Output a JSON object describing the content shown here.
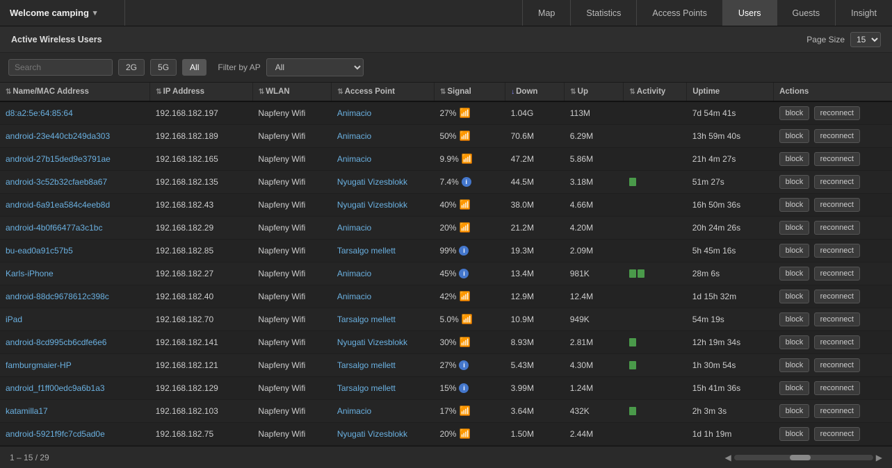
{
  "brand": {
    "name": "Welcome camping",
    "arrow": "▾"
  },
  "nav": {
    "tabs": [
      {
        "id": "map",
        "label": "Map",
        "active": false
      },
      {
        "id": "statistics",
        "label": "Statistics",
        "active": false
      },
      {
        "id": "access-points",
        "label": "Access Points",
        "active": false
      },
      {
        "id": "users",
        "label": "Users",
        "active": true
      },
      {
        "id": "guests",
        "label": "Guests",
        "active": false
      },
      {
        "id": "insight",
        "label": "Insight",
        "active": false
      }
    ]
  },
  "section": {
    "title": "Active Wireless Users",
    "page_size_label": "Page Size",
    "page_size_value": "15"
  },
  "filters": {
    "search_placeholder": "Search",
    "btn_2g": "2G",
    "btn_5g": "5G",
    "btn_all": "All",
    "filter_by_ap_label": "Filter by AP",
    "filter_by_ap_value": "All"
  },
  "table": {
    "columns": [
      {
        "id": "name",
        "label": "Name/MAC Address",
        "sort": "asc"
      },
      {
        "id": "ip",
        "label": "IP Address",
        "sort": "none"
      },
      {
        "id": "wlan",
        "label": "WLAN",
        "sort": "none"
      },
      {
        "id": "ap",
        "label": "Access Point",
        "sort": "none"
      },
      {
        "id": "signal",
        "label": "Signal",
        "sort": "none"
      },
      {
        "id": "down",
        "label": "Down",
        "sort": "desc"
      },
      {
        "id": "up",
        "label": "Up",
        "sort": "none"
      },
      {
        "id": "activity",
        "label": "Activity",
        "sort": "none"
      },
      {
        "id": "uptime",
        "label": "Uptime",
        "sort": "none"
      },
      {
        "id": "actions",
        "label": "Actions",
        "sort": "none"
      }
    ],
    "rows": [
      {
        "name": "d8:a2:5e:64:85:64",
        "ip": "192.168.182.197",
        "wlan": "Napfeny Wifi",
        "ap": "Animacio",
        "ap_link": true,
        "signal": "27%",
        "signal_type": "wifi",
        "down": "1.04G",
        "up": "113M",
        "activity": 0,
        "uptime": "7d 54m 41s"
      },
      {
        "name": "android-23e440cb249da303",
        "ip": "192.168.182.189",
        "wlan": "Napfeny Wifi",
        "ap": "Animacio",
        "ap_link": true,
        "signal": "50%",
        "signal_type": "wifi",
        "down": "70.6M",
        "up": "6.29M",
        "activity": 0,
        "uptime": "13h 59m 40s"
      },
      {
        "name": "android-27b15ded9e3791ae",
        "ip": "192.168.182.165",
        "wlan": "Napfeny Wifi",
        "ap": "Animacio",
        "ap_link": true,
        "signal": "9.9%",
        "signal_type": "wifi",
        "down": "47.2M",
        "up": "5.86M",
        "activity": 0,
        "uptime": "21h 4m 27s"
      },
      {
        "name": "android-3c52b32cfaeb8a67",
        "ip": "192.168.182.135",
        "wlan": "Napfeny Wifi",
        "ap": "Nyugati Vizesblokk",
        "ap_link": true,
        "signal": "7.4%",
        "signal_type": "info",
        "down": "44.5M",
        "up": "3.18M",
        "activity": 1,
        "uptime": "51m 27s"
      },
      {
        "name": "android-6a91ea584c4eeb8d",
        "ip": "192.168.182.43",
        "wlan": "Napfeny Wifi",
        "ap": "Nyugati Vizesblokk",
        "ap_link": true,
        "signal": "40%",
        "signal_type": "wifi",
        "down": "38.0M",
        "up": "4.66M",
        "activity": 0,
        "uptime": "16h 50m 36s"
      },
      {
        "name": "android-4b0f66477a3c1bc",
        "ip": "192.168.182.29",
        "wlan": "Napfeny Wifi",
        "ap": "Animacio",
        "ap_link": true,
        "signal": "20%",
        "signal_type": "wifi",
        "down": "21.2M",
        "up": "4.20M",
        "activity": 0,
        "uptime": "20h 24m 26s"
      },
      {
        "name": "bu-ead0a91c57b5",
        "ip": "192.168.182.85",
        "wlan": "Napfeny Wifi",
        "ap": "Tarsalgo mellett",
        "ap_link": true,
        "signal": "99%",
        "signal_type": "info",
        "down": "19.3M",
        "up": "2.09M",
        "activity": 0,
        "uptime": "5h 45m 16s"
      },
      {
        "name": "Karls-iPhone",
        "ip": "192.168.182.27",
        "wlan": "Napfeny Wifi",
        "ap": "Animacio",
        "ap_link": true,
        "signal": "45%",
        "signal_type": "info",
        "down": "13.4M",
        "up": "981K",
        "activity": 2,
        "uptime": "28m 6s"
      },
      {
        "name": "android-88dc9678612c398c",
        "ip": "192.168.182.40",
        "wlan": "Napfeny Wifi",
        "ap": "Animacio",
        "ap_link": true,
        "signal": "42%",
        "signal_type": "wifi",
        "down": "12.9M",
        "up": "12.4M",
        "activity": 0,
        "uptime": "1d 15h 32m"
      },
      {
        "name": "iPad",
        "ip": "192.168.182.70",
        "wlan": "Napfeny Wifi",
        "ap": "Tarsalgo mellett",
        "ap_link": true,
        "signal": "5.0%",
        "signal_type": "wifi",
        "down": "10.9M",
        "up": "949K",
        "activity": 0,
        "uptime": "54m 19s"
      },
      {
        "name": "android-8cd995cb6cdfe6e6",
        "ip": "192.168.182.141",
        "wlan": "Napfeny Wifi",
        "ap": "Nyugati Vizesblokk",
        "ap_link": true,
        "signal": "30%",
        "signal_type": "wifi",
        "down": "8.93M",
        "up": "2.81M",
        "activity": 1,
        "uptime": "12h 19m 34s"
      },
      {
        "name": "famburgmaier-HP",
        "ip": "192.168.182.121",
        "wlan": "Napfeny Wifi",
        "ap": "Tarsalgo mellett",
        "ap_link": true,
        "signal": "27%",
        "signal_type": "info",
        "down": "5.43M",
        "up": "4.30M",
        "activity": 1,
        "uptime": "1h 30m 54s"
      },
      {
        "name": "android_f1ff00edc9a6b1a3",
        "ip": "192.168.182.129",
        "wlan": "Napfeny Wifi",
        "ap": "Tarsalgo mellett",
        "ap_link": true,
        "signal": "15%",
        "signal_type": "info",
        "down": "3.99M",
        "up": "1.24M",
        "activity": 0,
        "uptime": "15h 41m 36s"
      },
      {
        "name": "katamilla17",
        "ip": "192.168.182.103",
        "wlan": "Napfeny Wifi",
        "ap": "Animacio",
        "ap_link": true,
        "signal": "17%",
        "signal_type": "wifi",
        "down": "3.64M",
        "up": "432K",
        "activity": 1,
        "uptime": "2h 3m 3s"
      },
      {
        "name": "android-5921f9fc7cd5ad0e",
        "ip": "192.168.182.75",
        "wlan": "Napfeny Wifi",
        "ap": "Nyugati Vizesblokk",
        "ap_link": true,
        "signal": "20%",
        "signal_type": "wifi",
        "down": "1.50M",
        "up": "2.44M",
        "activity": 0,
        "uptime": "1d 1h 19m"
      }
    ],
    "btn_block": "block",
    "btn_reconnect": "reconnect"
  },
  "footer": {
    "pagination": "1 – 15 / 29"
  }
}
